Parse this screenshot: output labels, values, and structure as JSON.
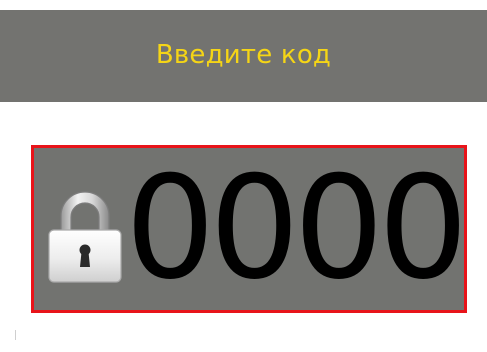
{
  "header": {
    "title": "Введите код"
  },
  "code_entry": {
    "value": "0000",
    "lock_icon": "padlock-locked-icon"
  },
  "colors": {
    "header_background": "#737370",
    "title_color": "#f5d516",
    "code_box_background": "#727370",
    "code_box_border": "#e8141a",
    "code_text": "#000000"
  }
}
